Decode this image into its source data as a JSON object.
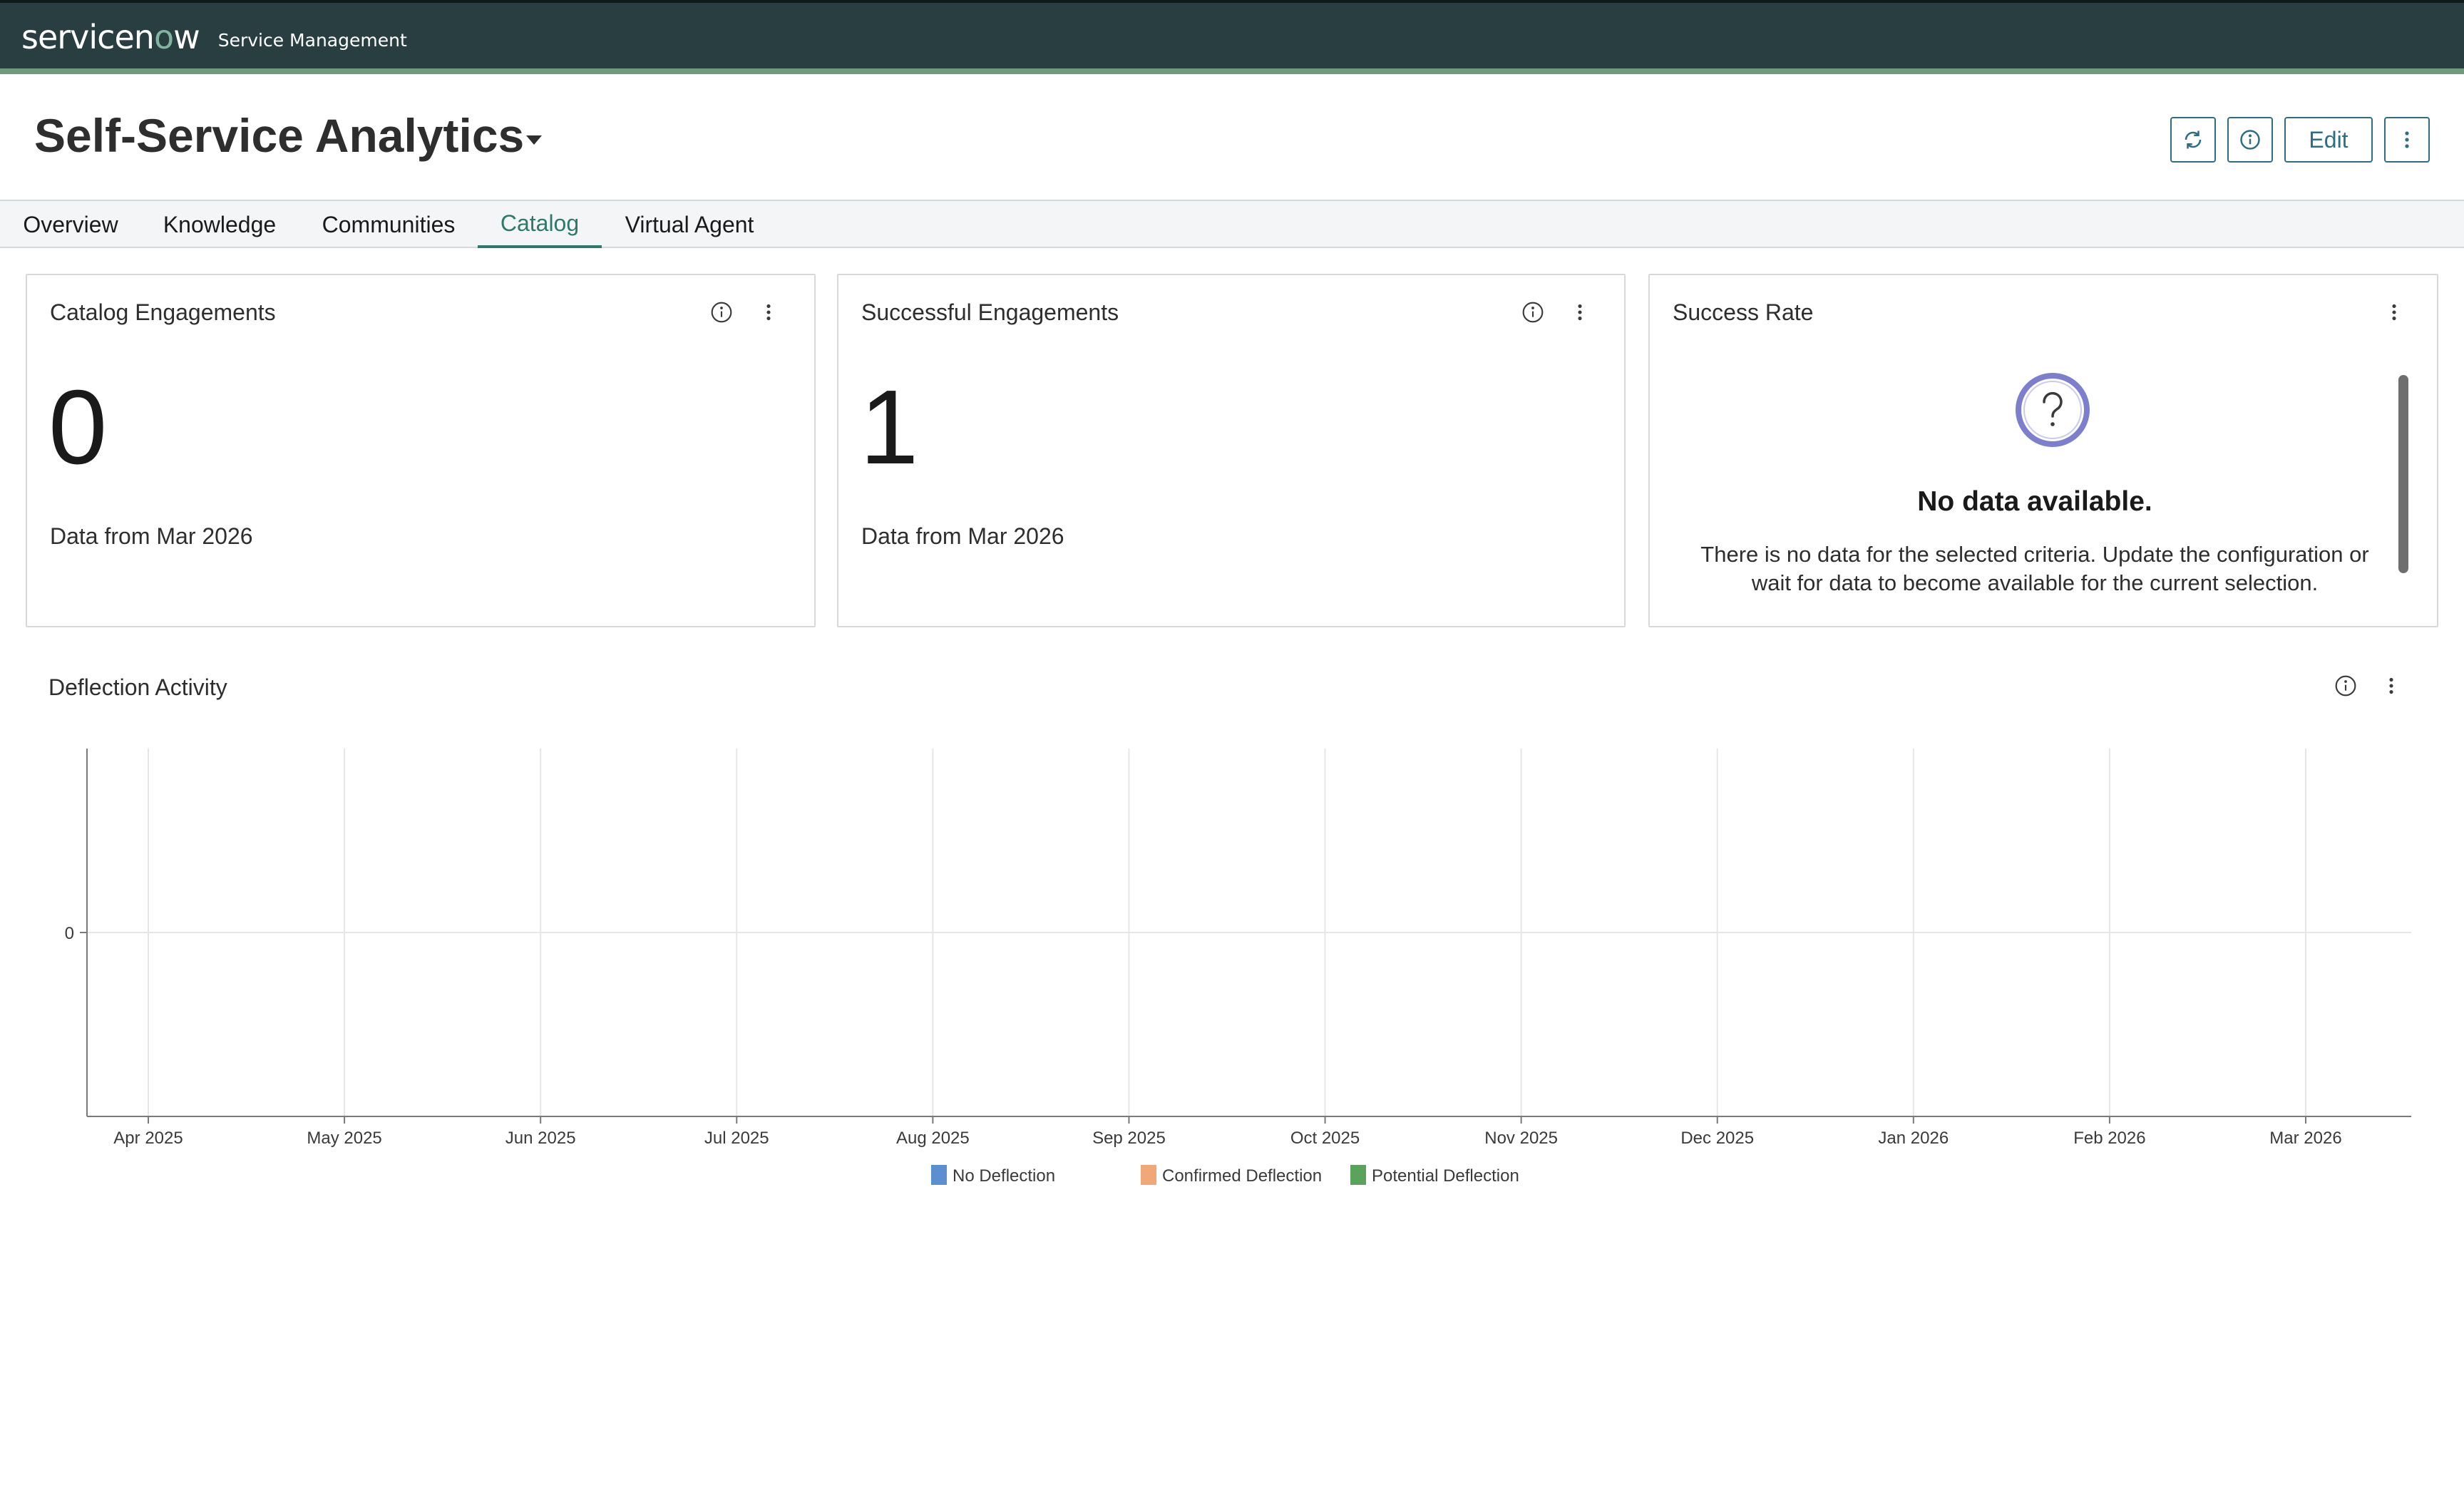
{
  "app": {
    "logo_text_before": "servicen",
    "logo_text_o": "o",
    "logo_text_after": "w",
    "product": "Service Management"
  },
  "header": {
    "title": "Self-Service Analytics",
    "edit_label": "Edit"
  },
  "tabs": [
    {
      "label": "Overview",
      "active": false
    },
    {
      "label": "Knowledge",
      "active": false
    },
    {
      "label": "Communities",
      "active": false
    },
    {
      "label": "Catalog",
      "active": true
    },
    {
      "label": "Virtual Agent",
      "active": false
    }
  ],
  "cards": {
    "catalog": {
      "title": "Catalog Engagements",
      "value": "0",
      "subtitle": "Data from Mar 2026"
    },
    "successful": {
      "title": "Successful Engagements",
      "value": "1",
      "subtitle": "Data from Mar 2026"
    },
    "success_rate": {
      "title": "Success Rate",
      "empty_title": "No data available.",
      "empty_text": "There is no data for the selected criteria. Update the configuration or wait for data to become available for the current selection."
    }
  },
  "colors": {
    "topbar": "#293e40",
    "accent": "#2d7a6a",
    "button": "#2d6e84",
    "no_deflection": "#5b8fd0",
    "confirmed_deflection": "#f0a878",
    "potential_deflection": "#5aa35a"
  },
  "chart_data": {
    "type": "bar",
    "title": "Deflection Activity",
    "categories": [
      "Apr 2025",
      "May 2025",
      "Jun 2025",
      "Jul 2025",
      "Aug 2025",
      "Sep 2025",
      "Oct 2025",
      "Nov 2025",
      "Dec 2025",
      "Jan 2026",
      "Feb 2026",
      "Mar 2026"
    ],
    "series": [
      {
        "name": "No Deflection",
        "color": "#5b8fd0",
        "values": [
          0,
          0,
          0,
          0,
          0,
          0,
          0,
          0,
          0,
          0,
          0,
          0
        ]
      },
      {
        "name": "Confirmed Deflection",
        "color": "#f0a878",
        "values": [
          0,
          0,
          0,
          0,
          0,
          0,
          0,
          0,
          0,
          0,
          0,
          0
        ]
      },
      {
        "name": "Potential Deflection",
        "color": "#5aa35a",
        "values": [
          0,
          0,
          0,
          0,
          0,
          0,
          0,
          0,
          0,
          0,
          0,
          0
        ]
      }
    ],
    "y_ticks": [
      "0"
    ],
    "grid": true,
    "legend": "bottom"
  }
}
